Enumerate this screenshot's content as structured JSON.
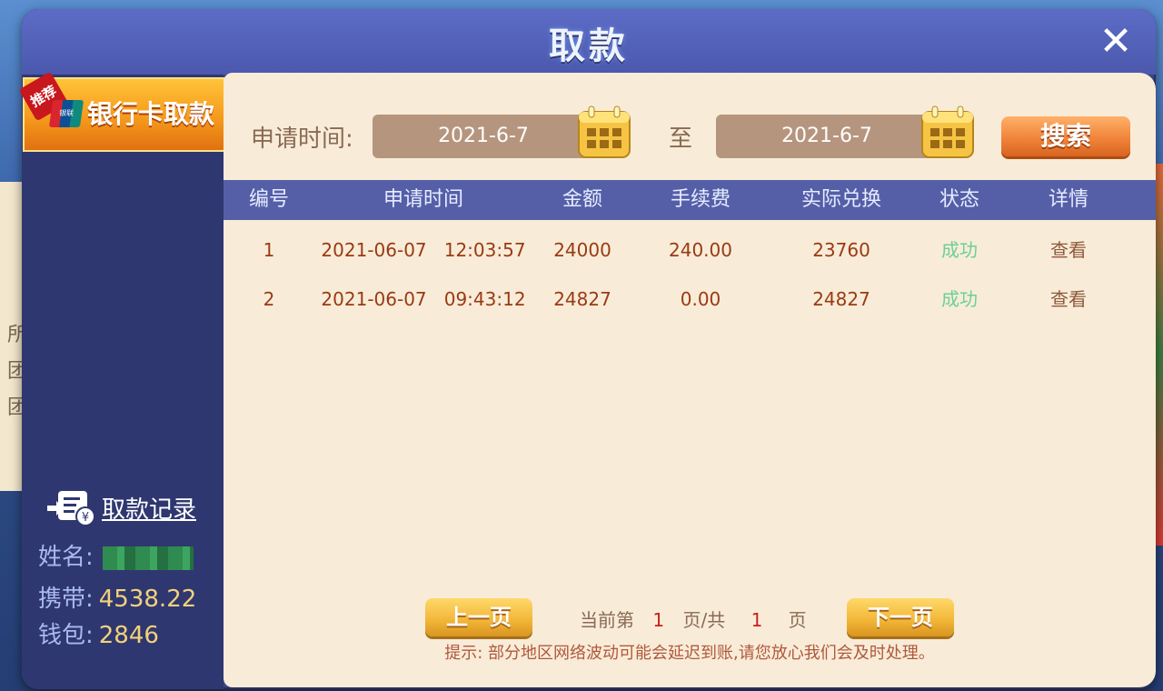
{
  "window": {
    "title": "取款",
    "close_icon": "close-icon"
  },
  "sidebar": {
    "tab": {
      "label": "银行卡取款",
      "badge": "推荐",
      "logo_text": "UnionPay 银联"
    },
    "record_link": "取款记录",
    "info": [
      {
        "label": "姓名:",
        "value": ""
      },
      {
        "label": "携带:",
        "value": "4538.22"
      },
      {
        "label": "钱包:",
        "value": "2846"
      }
    ]
  },
  "search": {
    "label": "申请时间:",
    "start_date": "2021-6-7",
    "to_label": "至",
    "end_date": "2021-6-7",
    "button": "搜索"
  },
  "table": {
    "headers": [
      "编号",
      "申请时间",
      "金额",
      "手续费",
      "实际兑换",
      "状态",
      "详情"
    ],
    "rows": [
      {
        "no": "1",
        "time": "2021-06-07   12:03:57",
        "amount": "24000",
        "fee": "240.00",
        "actual": "23760",
        "status": "成功",
        "detail": "查看"
      },
      {
        "no": "2",
        "time": "2021-06-07   09:43:12",
        "amount": "24827",
        "fee": "0.00",
        "actual": "24827",
        "status": "成功",
        "detail": "查看"
      }
    ]
  },
  "pager": {
    "prev": "上一页",
    "current_prefix": "当前第",
    "current": "1",
    "middle": "页/共",
    "total": "1",
    "suffix": "页",
    "next": "下一页"
  },
  "hint": "提示: 部分地区网络波动可能会延迟到账,请您放心我们会及时处理。",
  "colors": {
    "accent_orange": "#f1843a",
    "status_success": "#6dcf96",
    "panel_bg": "#f8ecd8",
    "header_blue": "#555fa8"
  }
}
